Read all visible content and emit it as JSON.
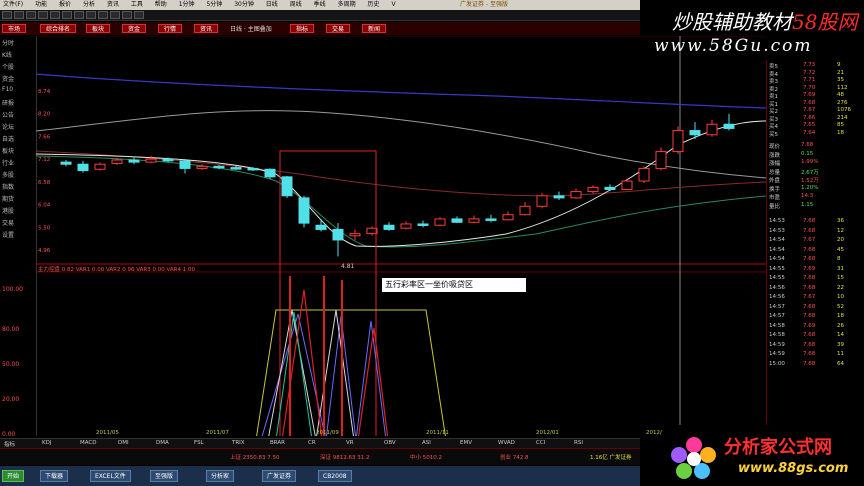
{
  "menubar": {
    "items": [
      "文件(F)",
      "功能",
      "报价",
      "分析",
      "资讯",
      "工具",
      "帮助",
      "1分钟",
      "5分钟",
      "30分钟",
      "日线",
      "周线",
      "季线",
      "多周期",
      "历史",
      "V"
    ],
    "center_title": "广发证券 - 至强版"
  },
  "funcbar": {
    "buttons": [
      "市场",
      "综合排名",
      "板块",
      "资金",
      "行情",
      "资讯",
      "指标",
      "交易",
      "新闻"
    ],
    "label": "日线 · 主图叠加"
  },
  "watermark": {
    "title_a": "炒股辅助教材",
    "title_b": "58股网",
    "url": "www.58Gu.com"
  },
  "leftnav": {
    "items": [
      "分时",
      "K线",
      "个股",
      "资金",
      "F10",
      "研报",
      "公告",
      "论坛",
      "自选",
      "板块",
      "行业",
      "多股",
      "指数",
      "期货",
      "港股",
      "交易",
      "设置"
    ]
  },
  "chart": {
    "indicator_label": "主力控盘  0.82  VAR1 0.00  VAR2 0.96  VAR3 0.00  VAR4 1.00",
    "low_label": "4.81",
    "annotation": "五行彩率区一坐价吸贷区",
    "y_labels": [
      "8.74",
      "8.20",
      "7.66",
      "7.12",
      "6.58",
      "6.04",
      "5.50",
      "4.96"
    ],
    "ind_y_labels": [
      "100.00",
      "80.00",
      "50.00",
      "20.00",
      "0.00"
    ],
    "x_labels": [
      "2011/05",
      "2011/07",
      "2011/09",
      "2011/11",
      "2012/01",
      "2012/03"
    ]
  },
  "candles": [
    {
      "o": 7.05,
      "c": 7.0,
      "h": 7.1,
      "l": 6.95,
      "up": false
    },
    {
      "o": 7.0,
      "c": 6.85,
      "h": 7.08,
      "l": 6.8,
      "up": false
    },
    {
      "o": 6.88,
      "c": 7.0,
      "h": 7.04,
      "l": 6.85,
      "up": true
    },
    {
      "o": 7.02,
      "c": 7.1,
      "h": 7.15,
      "l": 6.98,
      "up": true
    },
    {
      "o": 7.1,
      "c": 7.05,
      "h": 7.18,
      "l": 7.0,
      "up": false
    },
    {
      "o": 7.05,
      "c": 7.12,
      "h": 7.2,
      "l": 7.02,
      "up": true
    },
    {
      "o": 7.12,
      "c": 7.08,
      "h": 7.16,
      "l": 7.04,
      "up": false
    },
    {
      "o": 7.08,
      "c": 6.9,
      "h": 7.12,
      "l": 6.78,
      "up": false
    },
    {
      "o": 6.9,
      "c": 6.95,
      "h": 7.0,
      "l": 6.86,
      "up": true
    },
    {
      "o": 6.95,
      "c": 6.92,
      "h": 6.98,
      "l": 6.88,
      "up": false
    },
    {
      "o": 6.92,
      "c": 6.9,
      "h": 6.96,
      "l": 6.86,
      "up": false
    },
    {
      "o": 6.9,
      "c": 6.88,
      "h": 6.93,
      "l": 6.84,
      "up": false
    },
    {
      "o": 6.88,
      "c": 6.7,
      "h": 6.9,
      "l": 6.65,
      "up": false
    },
    {
      "o": 6.7,
      "c": 6.25,
      "h": 6.72,
      "l": 6.2,
      "up": false
    },
    {
      "o": 6.2,
      "c": 5.6,
      "h": 6.25,
      "l": 5.5,
      "up": false
    },
    {
      "o": 5.55,
      "c": 5.45,
      "h": 5.7,
      "l": 5.4,
      "up": false
    },
    {
      "o": 5.45,
      "c": 5.2,
      "h": 5.6,
      "l": 4.81,
      "up": false
    },
    {
      "o": 5.3,
      "c": 5.35,
      "h": 5.45,
      "l": 5.2,
      "up": true
    },
    {
      "o": 5.35,
      "c": 5.48,
      "h": 5.52,
      "l": 5.3,
      "up": true
    },
    {
      "o": 5.55,
      "c": 5.45,
      "h": 5.62,
      "l": 5.42,
      "up": false
    },
    {
      "o": 5.48,
      "c": 5.58,
      "h": 5.64,
      "l": 5.45,
      "up": true
    },
    {
      "o": 5.58,
      "c": 5.55,
      "h": 5.66,
      "l": 5.5,
      "up": false
    },
    {
      "o": 5.55,
      "c": 5.7,
      "h": 5.74,
      "l": 5.52,
      "up": true
    },
    {
      "o": 5.7,
      "c": 5.62,
      "h": 5.76,
      "l": 5.6,
      "up": false
    },
    {
      "o": 5.62,
      "c": 5.7,
      "h": 5.78,
      "l": 5.6,
      "up": true
    },
    {
      "o": 5.7,
      "c": 5.68,
      "h": 5.8,
      "l": 5.62,
      "up": false
    },
    {
      "o": 5.68,
      "c": 5.8,
      "h": 5.88,
      "l": 5.66,
      "up": true
    },
    {
      "o": 5.8,
      "c": 6.0,
      "h": 6.1,
      "l": 5.78,
      "up": true
    },
    {
      "o": 6.0,
      "c": 6.25,
      "h": 6.32,
      "l": 5.95,
      "up": true
    },
    {
      "o": 6.25,
      "c": 6.2,
      "h": 6.35,
      "l": 6.15,
      "up": false
    },
    {
      "o": 6.2,
      "c": 6.35,
      "h": 6.42,
      "l": 6.18,
      "up": true
    },
    {
      "o": 6.35,
      "c": 6.45,
      "h": 6.5,
      "l": 6.3,
      "up": true
    },
    {
      "o": 6.45,
      "c": 6.4,
      "h": 6.52,
      "l": 6.36,
      "up": false
    },
    {
      "o": 6.4,
      "c": 6.6,
      "h": 6.66,
      "l": 6.38,
      "up": true
    },
    {
      "o": 6.6,
      "c": 6.9,
      "h": 6.95,
      "l": 6.55,
      "up": true
    },
    {
      "o": 6.9,
      "c": 7.3,
      "h": 7.4,
      "l": 6.85,
      "up": true
    },
    {
      "o": 7.3,
      "c": 7.8,
      "h": 7.9,
      "l": 7.25,
      "up": true
    },
    {
      "o": 7.8,
      "c": 7.7,
      "h": 8.0,
      "l": 7.6,
      "up": false
    },
    {
      "o": 7.7,
      "c": 7.95,
      "h": 8.05,
      "l": 7.65,
      "up": true
    },
    {
      "o": 7.95,
      "c": 7.85,
      "h": 8.2,
      "l": 7.8,
      "up": false
    }
  ],
  "rightpanel": {
    "rows": [
      {
        "label": "卖5",
        "price": "7.73",
        "vol": "9"
      },
      {
        "label": "卖4",
        "price": "7.72",
        "vol": "21"
      },
      {
        "label": "卖3",
        "price": "7.71",
        "vol": "35"
      },
      {
        "label": "卖2",
        "price": "7.70",
        "vol": "112"
      },
      {
        "label": "卖1",
        "price": "7.69",
        "vol": "48"
      },
      {
        "label": "买1",
        "price": "7.68",
        "vol": "276"
      },
      {
        "label": "买2",
        "price": "7.67",
        "vol": "1076"
      },
      {
        "label": "买3",
        "price": "7.66",
        "vol": "214"
      },
      {
        "label": "买4",
        "price": "7.65",
        "vol": "85"
      },
      {
        "label": "买5",
        "price": "7.64",
        "vol": "18"
      }
    ],
    "stats": [
      {
        "label": "现价",
        "value": "7.68"
      },
      {
        "label": "涨跌",
        "value": "0.15"
      },
      {
        "label": "涨幅",
        "value": "1.99%"
      },
      {
        "label": "总量",
        "value": "2.67万"
      },
      {
        "label": "外盘",
        "value": "1.52万"
      },
      {
        "label": "换手",
        "value": "1.20%"
      },
      {
        "label": "市盈",
        "value": "14.3"
      },
      {
        "label": "量比",
        "value": "1.15"
      }
    ],
    "ticks": [
      [
        "14:53",
        "7.68",
        "36"
      ],
      [
        "14:53",
        "7.68",
        "12"
      ],
      [
        "14:54",
        "7.67",
        "20"
      ],
      [
        "14:54",
        "7.68",
        "45"
      ],
      [
        "14:54",
        "7.68",
        "8"
      ],
      [
        "14:55",
        "7.69",
        "31"
      ],
      [
        "14:55",
        "7.68",
        "15"
      ],
      [
        "14:56",
        "7.68",
        "22"
      ],
      [
        "14:56",
        "7.67",
        "10"
      ],
      [
        "14:57",
        "7.68",
        "52"
      ],
      [
        "14:57",
        "7.68",
        "18"
      ],
      [
        "14:58",
        "7.69",
        "26"
      ],
      [
        "14:58",
        "7.68",
        "14"
      ],
      [
        "14:59",
        "7.68",
        "39"
      ],
      [
        "14:59",
        "7.68",
        "11"
      ],
      [
        "15:00",
        "7.68",
        "64"
      ]
    ]
  },
  "bottomtabs": {
    "items": [
      "指标",
      "KDJ",
      "MACD",
      "DMI",
      "DMA",
      "FSL",
      "TRIX",
      "BRAR",
      "CR",
      "VR",
      "OBV",
      "ASI",
      "EMV",
      "WVAD",
      "CCI",
      "RSI"
    ]
  },
  "statusbar": {
    "items": [
      "上证 2350.83  7.50",
      "深证 9812.63  31.2",
      "中小 5010.2",
      "创业 742.8",
      "1.16亿 广发证券"
    ]
  },
  "taskbar": {
    "items": [
      "开始",
      "下载器",
      "EXCEL文件",
      "至强版",
      "分析家",
      "广发证券",
      "CB2008"
    ]
  },
  "logo": {
    "title": "分析家公式网",
    "url": "www.88gs.com"
  }
}
